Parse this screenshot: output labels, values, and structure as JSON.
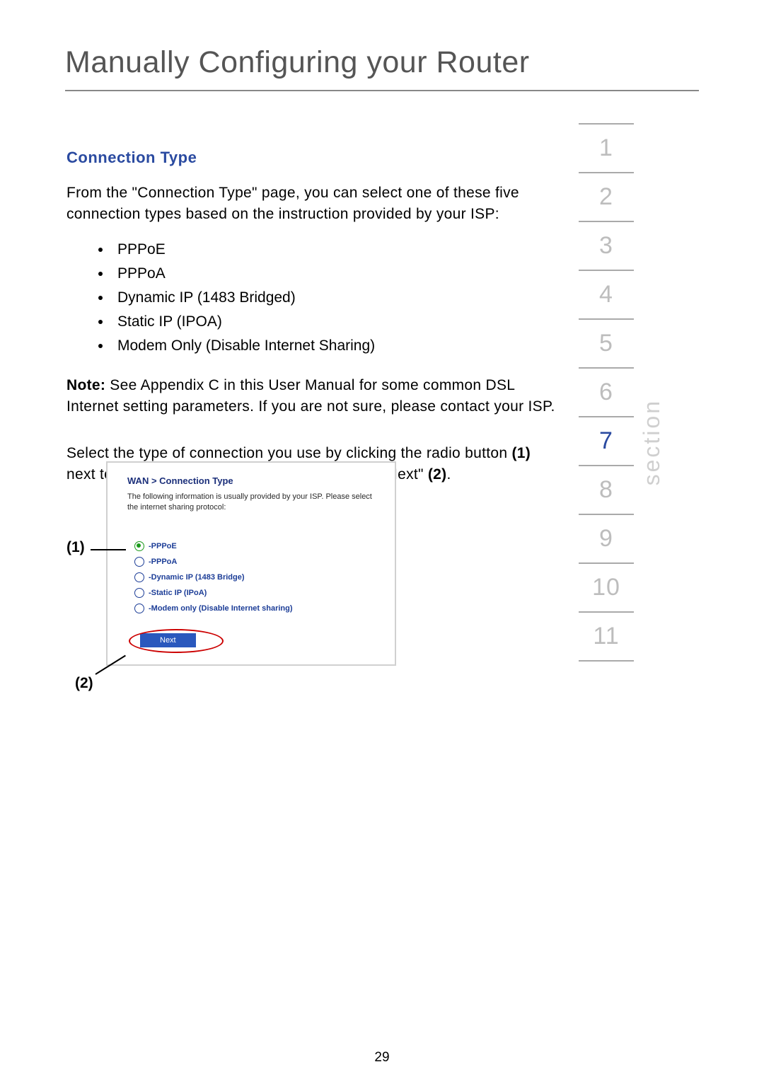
{
  "header": {
    "title": "Manually Configuring your Router"
  },
  "section_label": "section",
  "section_numbers": [
    "1",
    "2",
    "3",
    "4",
    "5",
    "6",
    "7",
    "8",
    "9",
    "10",
    "11"
  ],
  "section_active_index": 6,
  "body": {
    "subtitle": "Connection Type",
    "intro": "From the \"Connection Type\" page, you can select one of these five connection types based on the instruction provided by your ISP:",
    "bullets": [
      "PPPoE",
      "PPPoA",
      "Dynamic IP (1483 Bridged)",
      "Static IP (IPOA)",
      "Modem Only (Disable Internet Sharing)"
    ],
    "note_bold": "Note:",
    "note_rest": " See Appendix C in this User Manual for some common DSL Internet setting parameters. If you are not sure, please contact your ISP.",
    "instruction_a": "Select the type of connection you use by clicking the radio button ",
    "instruction_ref1": "(1)",
    "instruction_b": " next to your connection type and then clicking \"Next\" ",
    "instruction_ref2": "(2)",
    "instruction_c": "."
  },
  "panel": {
    "breadcrumb_parent": "WAN",
    "breadcrumb_sep": " > ",
    "breadcrumb_child": "Connection Type",
    "desc": "The following information is usually provided by your ISP. Please select the internet sharing protocol:",
    "options": [
      {
        "label": "-PPPoE",
        "selected": true
      },
      {
        "label": "-PPPoA",
        "selected": false
      },
      {
        "label": "-Dynamic IP (1483 Bridge)",
        "selected": false
      },
      {
        "label": "-Static IP (IPoA)",
        "selected": false
      },
      {
        "label": "-Modem only (Disable Internet sharing)",
        "selected": false
      }
    ],
    "next_label": "Next"
  },
  "callouts": {
    "one": "(1)",
    "two": "(2)"
  },
  "page_number": "29"
}
